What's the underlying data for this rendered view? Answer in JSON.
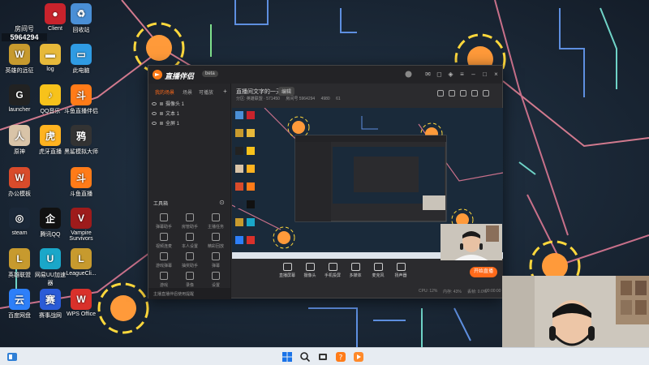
{
  "desktop": {
    "room_label": "房间号",
    "room_number": "5964294",
    "icons": [
      {
        "name": "game-client-icon",
        "label": "Client",
        "color": "#c8232c"
      },
      {
        "name": "recycle-bin-icon",
        "label": "回收站",
        "color": "#4a8fd6"
      },
      {
        "name": "lol-legend-icon",
        "label": "英雄的远征",
        "color": "#c79a2e"
      },
      {
        "name": "log-folder-icon",
        "label": "log",
        "color": "#e7b93a"
      },
      {
        "name": "computer-icon",
        "label": "此电脑",
        "color": "#2f9be3"
      },
      {
        "name": "launcher-icon",
        "label": "launcher",
        "color": "#222222"
      },
      {
        "name": "qq-music-icon",
        "label": "QQ音乐",
        "color": "#f7c21b"
      },
      {
        "name": "douyu-streamer-icon",
        "label": "斗鱼直播伴侣",
        "color": "#ff7b18"
      },
      {
        "name": "genshin-icon",
        "label": "原神",
        "color": "#d9c4a8"
      },
      {
        "name": "huya-icon",
        "label": "虎牙直播",
        "color": "#ffb320"
      },
      {
        "name": "raven-icon",
        "label": "黑鲨模拟大师",
        "color": "#333333"
      },
      {
        "name": "wps-office-icon",
        "label": "办公模板",
        "color": "#d94b2b"
      },
      {
        "name": "douyu-live-icon",
        "label": "斗鱼直播",
        "color": "#ff7b18"
      },
      {
        "name": "steam-icon",
        "label": "steam",
        "color": "#1b2838"
      },
      {
        "name": "tencent-qq-icon",
        "label": "腾讯QQ",
        "color": "#111111"
      },
      {
        "name": "vampire-survivors-icon",
        "label": "Vampire Survivors",
        "color": "#9e1b1b"
      },
      {
        "name": "lol-client-icon",
        "label": "英雄联盟",
        "color": "#c79a2e"
      },
      {
        "name": "netease-uu-icon",
        "label": "网易UU加速器",
        "color": "#1aa7c9"
      },
      {
        "name": "league-client-icon",
        "label": "LeagueCli...",
        "color": "#c79a2e"
      },
      {
        "name": "baidu-netdisk-icon",
        "label": "百度网盘",
        "color": "#2d7ff9"
      },
      {
        "name": "esports-arena-icon",
        "label": "赛事战网",
        "color": "#2a5bd7"
      },
      {
        "name": "wps-icon",
        "label": "WPS Office",
        "color": "#d9312b"
      }
    ]
  },
  "streamer_app": {
    "title": "直播伴侣",
    "badge": "beta",
    "tabs": [
      "我的场景",
      "场景",
      "可播放"
    ],
    "sources": [
      "摄像头 1",
      "文本 1",
      "全屏 1"
    ],
    "toolbox_title": "工具箱",
    "tools": [
      "弹幕助手",
      "房管助手",
      "主播任务",
      "视频连麦",
      "本人设置",
      "精彩回放",
      "游戏弹幕",
      "抽奖助手",
      "弹幕",
      "游戏",
      "录像",
      "设置"
    ],
    "status_text": "主播直播伴侣使用提醒",
    "room_title": "直播间文字的一天",
    "room_edit": "编辑",
    "room_meta": [
      "分区: 英雄联盟 · 571450",
      "房间号 5964294",
      "4980",
      "61"
    ],
    "bottom_tools": [
      "直播屏幕",
      "摄像头",
      "手机投屏",
      "多媒体",
      "麦克风",
      "扬声器"
    ],
    "go_live": "开始直播",
    "stats": [
      "CPU: 12%",
      "内存: 43%",
      "丢帧: 0.0%",
      "00:00:00"
    ]
  },
  "taskbar": {
    "items": [
      "start-icon",
      "search-icon",
      "file-explorer-icon",
      "douyu-taskbar-icon",
      "streamer-taskbar-icon"
    ]
  }
}
